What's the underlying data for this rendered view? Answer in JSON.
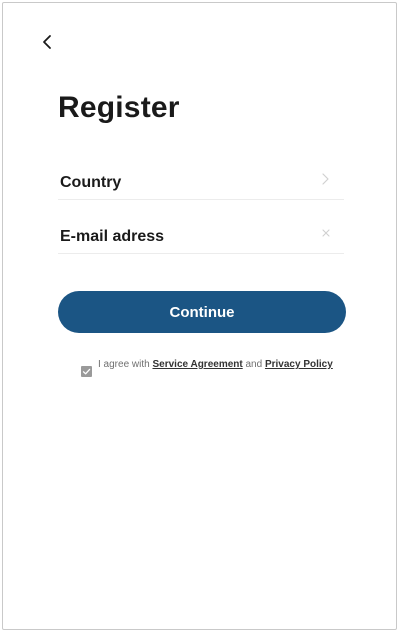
{
  "header": {
    "back_icon": "chevron-left-icon"
  },
  "page": {
    "title": "Register"
  },
  "form": {
    "country": {
      "label": "Country",
      "icon": "chevron-right-icon"
    },
    "email": {
      "placeholder": "E-mail adress",
      "value": "",
      "clear_icon": "close-icon"
    },
    "continue_label": "Continue"
  },
  "agreement": {
    "checked": true,
    "checkbox_icon": "checkmark-icon",
    "text_before": "I agree with ",
    "service_link": "Service Agreement",
    "text_middle": " and ",
    "privacy_link": "Privacy Policy"
  },
  "colors": {
    "primary": "#1b5584",
    "text": "#1a1a1a",
    "muted": "#707070",
    "divider": "#ececec"
  }
}
